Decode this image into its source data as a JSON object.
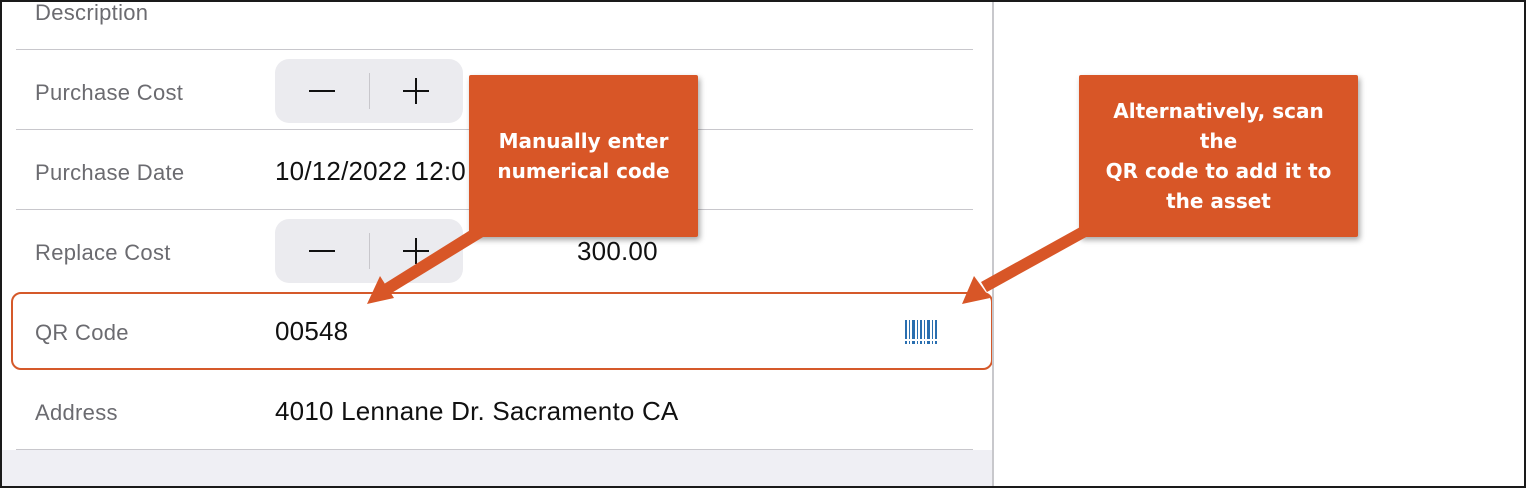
{
  "form": {
    "rows": [
      {
        "label": "Description",
        "value": ""
      },
      {
        "label": "Purchase Cost",
        "value": ""
      },
      {
        "label": "Purchase Date",
        "value": "10/12/2022 12:0"
      },
      {
        "label": "Replace Cost",
        "value": "300.00"
      },
      {
        "label": "QR Code",
        "value": "00548"
      },
      {
        "label": "Address",
        "value": "4010 Lennane Dr. Sacramento CA"
      }
    ],
    "stepper": {
      "minus": "−",
      "plus": "+"
    }
  },
  "callouts": {
    "manual": {
      "line1": "Manually enter",
      "line2": "numerical code"
    },
    "scan": {
      "line1": "Alternatively, scan the",
      "line2": "QR code to add it to",
      "line3": "the asset"
    }
  },
  "colors": {
    "callout": "#d85627",
    "highlight": "#d5592a",
    "barcode_icon": "#2a6fb0",
    "label_text": "#6b6b70",
    "value_text": "#111111"
  },
  "icons": {
    "scan": "barcode-icon"
  }
}
